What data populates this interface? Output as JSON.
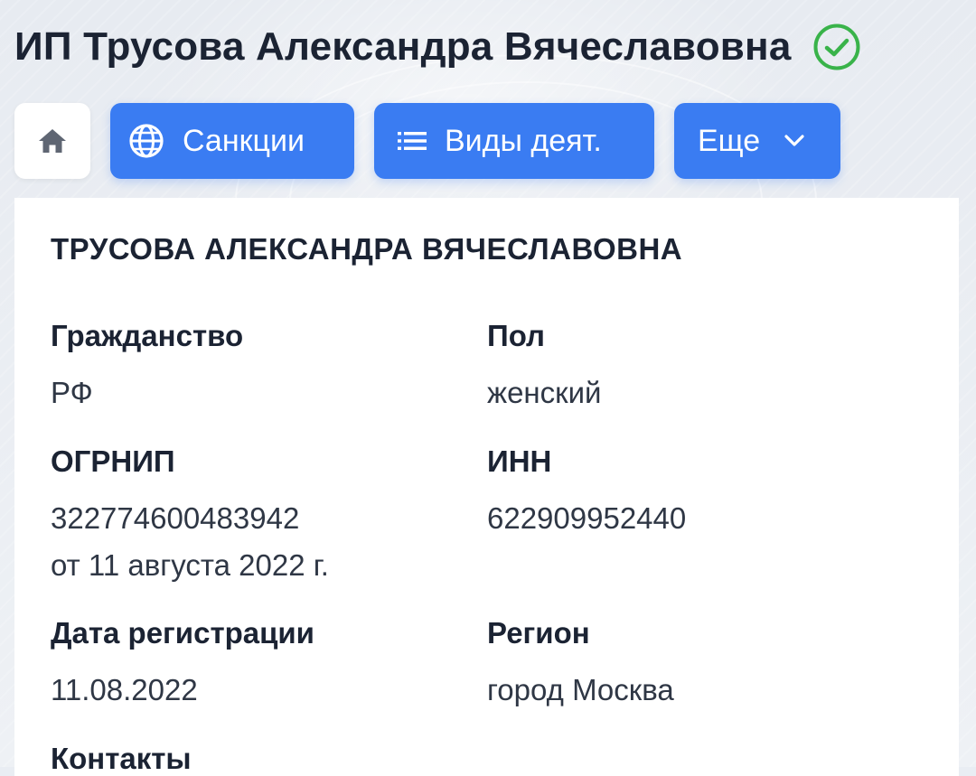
{
  "header": {
    "title": "ИП Трусова Александра Вячеславовна",
    "verified_icon": "check-circle-icon",
    "accent_green": "#39b34a"
  },
  "nav": {
    "home_icon": "home-icon",
    "buttons": [
      {
        "label": "Санкции",
        "icon": "globe-icon"
      },
      {
        "label": "Виды деят.",
        "icon": "list-icon"
      },
      {
        "label": "Еще",
        "icon": "chevron-down-icon"
      }
    ],
    "accent_blue": "#3a7cf2"
  },
  "card": {
    "owner_name": "ТРУСОВА АЛЕКСАНДРА ВЯЧЕСЛАВОВНА",
    "fields": {
      "citizenship": {
        "label": "Гражданство",
        "value": "РФ"
      },
      "gender": {
        "label": "Пол",
        "value": "женский"
      },
      "ogrnip": {
        "label": "ОГРНИП",
        "value": "322774600483942",
        "date": "от 11 августа 2022 г."
      },
      "inn": {
        "label": "ИНН",
        "value": "622909952440"
      },
      "registration_date": {
        "label": "Дата регистрации",
        "value": "11.08.2022"
      },
      "region": {
        "label": "Регион",
        "value": "город Москва"
      },
      "contacts": {
        "label": "Контакты"
      }
    }
  }
}
